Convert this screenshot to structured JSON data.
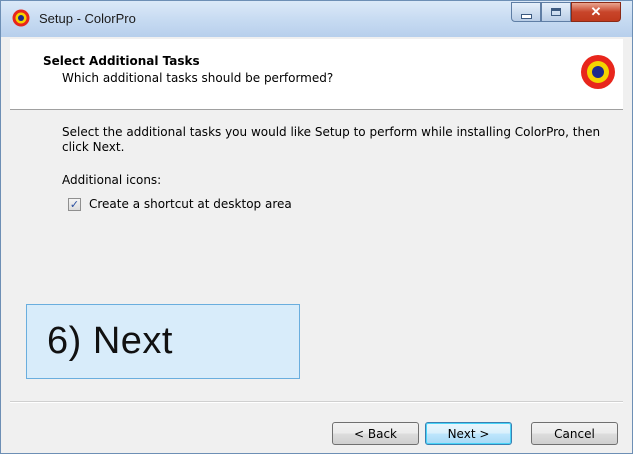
{
  "window": {
    "title": "Setup - ColorPro"
  },
  "header": {
    "title": "Select Additional Tasks",
    "subtitle": "Which additional tasks should be performed?"
  },
  "content": {
    "description": "Select the additional tasks you would like Setup to perform while installing ColorPro, then click Next.",
    "icons_label": "Additional icons:",
    "tasks": [
      {
        "label": "Create a shortcut at desktop area",
        "checked": true
      }
    ]
  },
  "annotation": {
    "text": "6) Next"
  },
  "buttons": {
    "back": "< Back",
    "next": "Next >",
    "cancel": "Cancel"
  },
  "icons": {
    "app": "colorpro-logo-icon",
    "minimize": "minimize-icon",
    "maximize": "maximize-icon",
    "close": "close-icon",
    "checkmark": "checkmark-icon"
  },
  "colors": {
    "logo_outer": "#e8261c",
    "logo_middle": "#f4d400",
    "logo_inner": "#1d2a8c",
    "callout_fill": "#d8ecfa",
    "callout_border": "#6aaede"
  }
}
